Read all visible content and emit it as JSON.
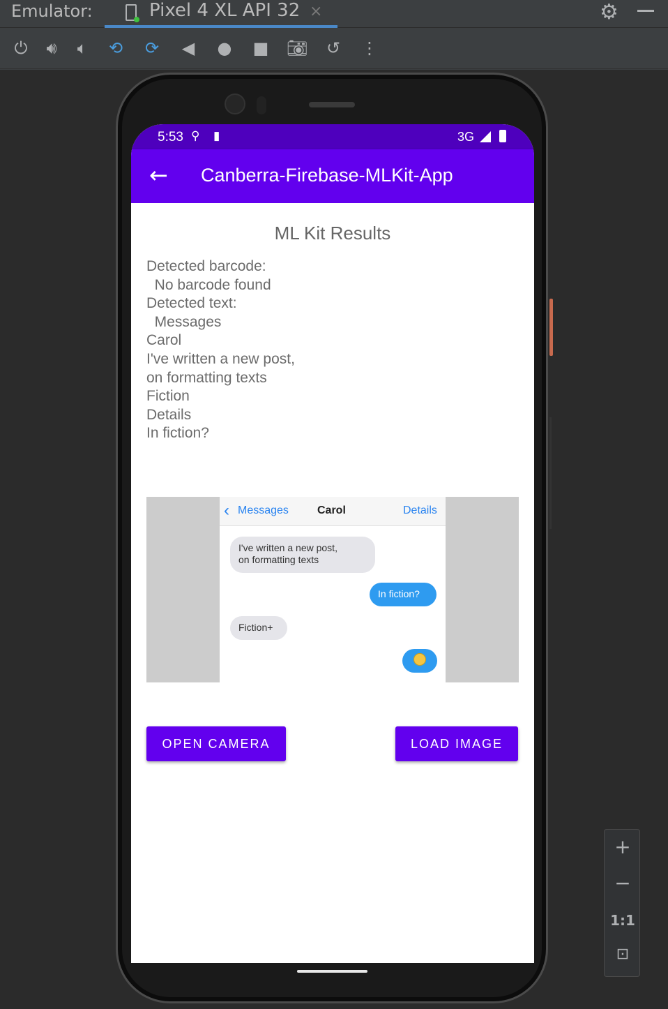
{
  "ide": {
    "emulator_label": "Emulator:",
    "tab_title": "Pixel 4 XL API 32",
    "tab_close": "×",
    "toolbar_icons": [
      "power-icon",
      "volume-up-icon",
      "volume-down-icon",
      "rotate-left-icon",
      "rotate-right-icon",
      "back-icon",
      "home-icon",
      "overview-icon",
      "screenshot-icon",
      "snapshot-icon",
      "more-icon"
    ]
  },
  "device": {
    "status": {
      "time": "5:53",
      "network": "3G"
    },
    "appbar": {
      "back": "←",
      "title": "Canberra-Firebase-MLKit-App"
    }
  },
  "app": {
    "results_title": "ML Kit Results",
    "results_text": "Detected barcode:\n  No barcode found\nDetected text:\n  Messages\nCarol\nI've written a new post,\non formatting texts\nFiction\nDetails\nIn fiction?",
    "preview": {
      "header_back": "Messages",
      "header_name": "Carol",
      "header_details": "Details",
      "bubble1": "I've written a new post,\non formatting texts",
      "bubble2": "In fiction?",
      "bubble3": "Fiction+"
    },
    "buttons": {
      "open_camera": "OPEN CAMERA",
      "load_image": "LOAD IMAGE"
    }
  },
  "zoom": {
    "zoom_in": "+",
    "zoom_out": "−",
    "one_to_one": "1:1"
  }
}
